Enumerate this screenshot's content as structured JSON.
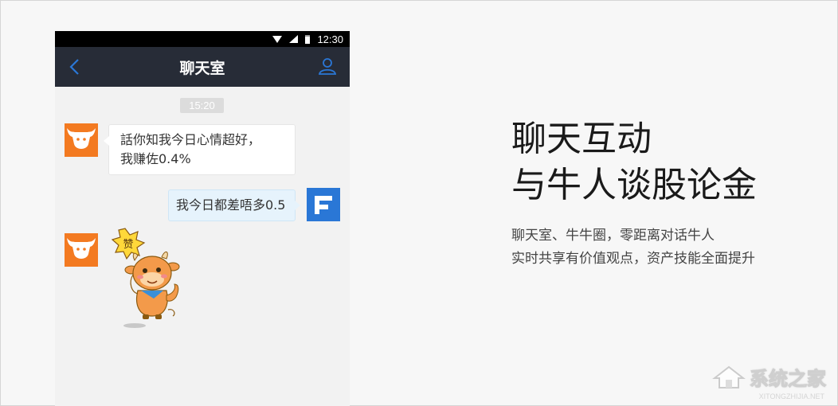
{
  "status_bar": {
    "time": "12:30"
  },
  "nav": {
    "title": "聊天室"
  },
  "chat": {
    "timestamp": "15:20",
    "messages": [
      {
        "direction": "incoming",
        "lines": [
          "話你知我今日心情超好，",
          "我赚佐0.4%"
        ]
      },
      {
        "direction": "outgoing",
        "lines": [
          "我今日都差唔多0.5"
        ]
      },
      {
        "direction": "incoming",
        "sticker": "bull-thumbs-up-sticker",
        "sticker_text": "赞"
      }
    ]
  },
  "promo": {
    "headline_lines": [
      "聊天互动",
      "与牛人谈股论金"
    ],
    "sub_lines": [
      "聊天室、牛牛圈，零距离对话牛人",
      "实时共享有价值观点，资产技能全面提升"
    ]
  },
  "watermark": {
    "text": "系统之家",
    "url": "XITONGZHIJIA.NET"
  },
  "colors": {
    "nav_bg": "#272c37",
    "accent_blue": "#2a77d6",
    "bull_orange": "#f37a21",
    "outgoing_bubble": "#e6f3fc"
  }
}
